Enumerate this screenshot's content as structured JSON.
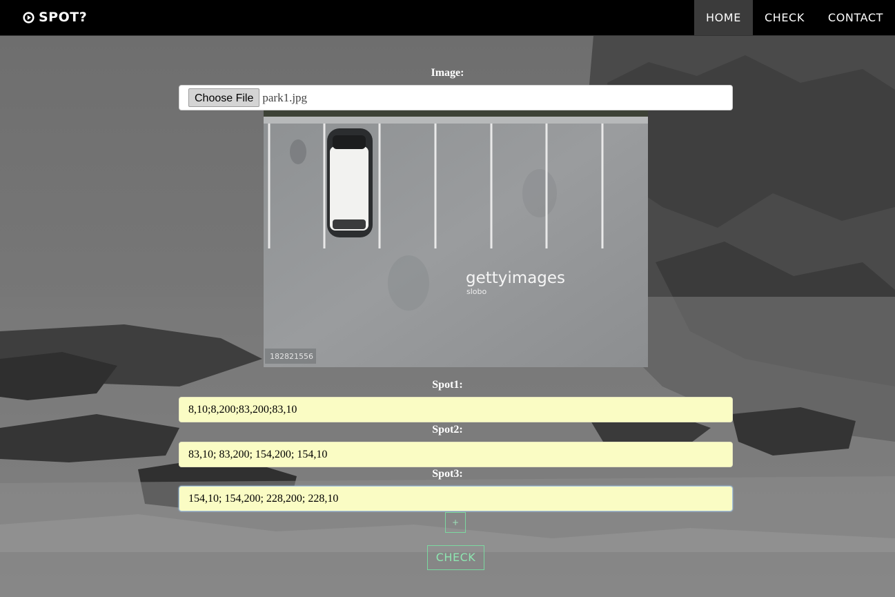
{
  "brand": {
    "name": "SPOT?",
    "icon": "play-circle-icon"
  },
  "nav": {
    "home": "HOME",
    "check": "CHECK",
    "contact": "CONTACT",
    "active": "HOME"
  },
  "form": {
    "image_label": "Image:",
    "choose_file": "Choose File",
    "file_name": "park1.jpg",
    "spots": [
      {
        "label": "Spot1:",
        "value": "8,10;8,200;83,200;83,10"
      },
      {
        "label": "Spot2:",
        "value": "83,10; 83,200; 154,200; 154,10"
      },
      {
        "label": "Spot3:",
        "value": "154,10; 154,200; 228,200; 228,10"
      }
    ],
    "add_button": "+",
    "check_button": "CHECK"
  },
  "preview": {
    "watermark_brand": "gettyimages",
    "watermark_credit": "slobo",
    "image_id": "182821556"
  },
  "colors": {
    "navbar": "#000000",
    "input_fill": "#fafcc4",
    "accent_green": "#7bd9a0"
  }
}
